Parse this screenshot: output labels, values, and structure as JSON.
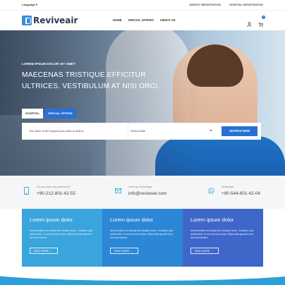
{
  "topbar": {
    "language": "Language",
    "links": [
      "AGENCY REGISTRATION",
      "HOSPITAL REGISTRATION"
    ]
  },
  "header": {
    "logo_text": "Reviveair",
    "nav": [
      "HOME",
      "SPECIAL OFFERS",
      "ABOUT US"
    ],
    "cart_count": "0"
  },
  "hero": {
    "kicker": "LOREM IPSUM DOLOR SIT AMET",
    "headline": "MAECENAS TRISTIQUE EFFICITUR ULTRICES. VESTIBULUM AT NISI ORCI.",
    "tabs": [
      "HOSPITAL",
      "SPECIAL OFFERS"
    ],
    "search_placeholder": "The name of the keyword you want to search",
    "select_label": "Select State",
    "search_button": "SEARCH NOW"
  },
  "contact": [
    {
      "label": "Do you have any questions?",
      "value": "+90-212-801-42-55",
      "icon": "phone-icon"
    },
    {
      "label": "Send us a Message",
      "value": "info@reviveair.com",
      "icon": "mail-icon"
    },
    {
      "label": "WhatsApp",
      "value": "+90-544-801-42-04",
      "icon": "whatsapp-icon"
    }
  ],
  "cards": [
    {
      "title": "Lorem ipsum dolor",
      "text": "Morbi eleifend dui lacinia elit volutpat rutrum. Curabitur quis lacinia nibh. In non rhoncus neque. Maecenas gravida eros non erat ultrices.",
      "button": "READ MORE →",
      "color": "#3aa4dc"
    },
    {
      "title": "Lorem ipsum dolor",
      "text": "Morbi eleifend dui lacinia elit volutpat rutrum. Curabitur quis lacinia nibh. In non rhoncus neque. Maecenas gravida eros non erat ultrices.",
      "button": "READ MORE →",
      "color": "#2c87d6"
    },
    {
      "title": "Lorem ipsum dolor",
      "text": "Morbi eleifend dui lacinia elit volutpat rutrum. Curabitur quis lacinia nibh. In non rhoncus neque. Maecenas gravida eros non erat ultrices.",
      "button": "READ MORE →",
      "color": "#3f67c9"
    }
  ],
  "colors": {
    "accent": "#2a6fd6",
    "footer": "#2b9fd9"
  }
}
